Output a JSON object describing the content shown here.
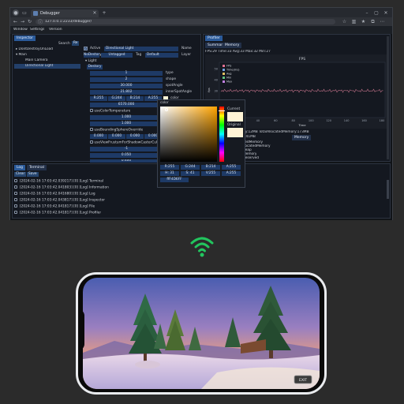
{
  "browser": {
    "tab_title": "Debugger",
    "url": "127.0.0.1:2233/debugger/"
  },
  "menu": {
    "items": [
      "Window",
      "Settings",
      "Version"
    ]
  },
  "inspector": {
    "tab": "Inspector",
    "search_label": "Search",
    "search_short": "Re",
    "tree": [
      "DontDestroyOnLoad",
      "Main",
      "Main Camera",
      "Directional Light"
    ],
    "active_label": "Active",
    "object_name": "Directional Light",
    "name_label": "Name",
    "nodestroy": "NoDestory",
    "untagged": "Untagged",
    "tag_label": "Tag",
    "layer_value": "Default",
    "layer_label": "Layer",
    "component_title": "Light",
    "destroy_btn": "Destory",
    "props": [
      {
        "value": "1",
        "label": "type"
      },
      {
        "value": "2",
        "label": "shape"
      },
      {
        "value": "30.000",
        "label": "spotAngle"
      },
      {
        "value": "21.802",
        "label": "innerSpotAngle"
      }
    ],
    "color_fields": [
      "R:255",
      "G:244",
      "B:214",
      "A:255"
    ],
    "color_label": "color",
    "temperature": "6570.000",
    "use_color_temp": "useColorTemperature",
    "intensity": "1.000",
    "bounce": "1.000",
    "bounding_sphere": "useBoundingSphereOverride",
    "sphere_values": [
      "0.000",
      "0.000",
      "0.000",
      "0.000"
    ],
    "shadow_culling": "useViewFrustumForShadowCasterCull",
    "shadow_values": [
      "-1",
      "0.050",
      "0.400"
    ]
  },
  "color_picker": {
    "title": "color",
    "current": "Current",
    "original": "Original",
    "rgba_row1": [
      "R:255",
      "G:244",
      "B:214",
      "A:255"
    ],
    "hsv_row": [
      "H: 31",
      "S: 41",
      "V:255",
      "A:255"
    ],
    "hex": "ffF4D6FF"
  },
  "profiler": {
    "tab": "Profiler",
    "subtabs": [
      "Summary",
      "Memory"
    ],
    "fps_line": "FPS:29 Time:33 Avg:33 Max:32 Min:27",
    "chart_title": "FPS",
    "legend": [
      "FPS",
      "Time(ms)",
      "Avg",
      "Min",
      "Max"
    ],
    "ylabel": "fps",
    "xlabel": "Time",
    "x_ticks": [
      "0",
      "20",
      "40",
      "60",
      "80",
      "100",
      "120",
      "140",
      "160",
      "180"
    ],
    "y_ticks": [
      "50",
      "40",
      "30",
      "20",
      "10"
    ],
    "mem_line": "19MB MonoUsedMemory:12MB TotalAllocatedMemory:173MB",
    "mem_line2": "nusedReservedMemory:41MB",
    "mem_tab": "Memory",
    "mem_items": [
      "sedMemory",
      "llocatedMemory",
      "heap",
      "Memory",
      "Reserved"
    ]
  },
  "log": {
    "tabs": [
      "Log",
      "Terminal"
    ],
    "buttons": [
      "Clear",
      "Save"
    ],
    "lines": [
      "[2024-02-16 17:03:42.039217] [0] [Log] Terminal",
      "[2024-02-16 17:03:42.041803] [0] [Log] Information",
      "[2024-02-16 17:03:42.041680] [0] [Log] Log",
      "[2024-02-16 17:03:42.043817] [0] [Log] Inspector",
      "[2024-02-16 17:03:42.041817] [0] [Log] File",
      "[2024-02-16 17:03:42.041817] [0] [Log] Profiler"
    ]
  },
  "game": {
    "button_label": "EXIT"
  },
  "colors": {
    "accent": "#2a5a9a",
    "wifi": "#22c55e",
    "fps_line": "#c07088"
  }
}
